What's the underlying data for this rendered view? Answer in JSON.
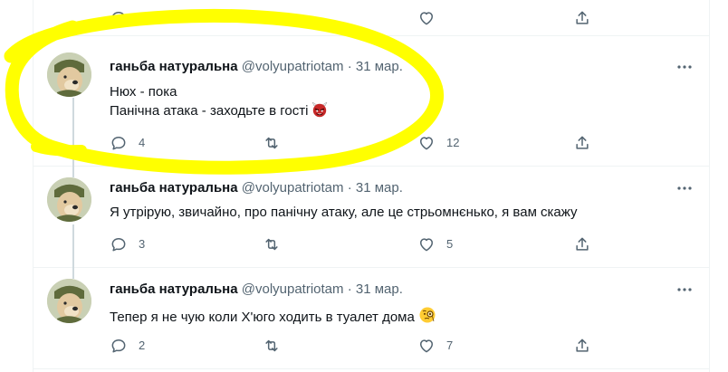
{
  "tweets": [
    {
      "author_name": "ганьба натуральна",
      "handle": "@volyupatriotam",
      "date": "31 мар.",
      "lines": [
        "Нюх - пока",
        "Панічна атака - заходьте в гості"
      ],
      "emoji": "ogre-face",
      "replies": "4",
      "retweets": "",
      "likes": "12"
    },
    {
      "author_name": "ганьба натуральна",
      "handle": "@volyupatriotam",
      "date": "31 мар.",
      "lines": [
        "Я утрірую, звичайно, про панічну атаку, але це стрьомнєнько, я вам скажу"
      ],
      "replies": "3",
      "retweets": "",
      "likes": "5"
    },
    {
      "author_name": "ганьба натуральна",
      "handle": "@volyupatriotam",
      "date": "31 мар.",
      "lines": [
        "Тепер я не чую коли Х'юго ходить в туалет дома"
      ],
      "emoji": "face-with-monocle",
      "replies": "2",
      "retweets": "",
      "likes": "7"
    }
  ],
  "separator": "·",
  "colors": {
    "text": "#0f1419",
    "secondary": "#536471",
    "border": "#eff3f4",
    "thread_line": "#cfd9de",
    "highlight": "#ffff00"
  }
}
